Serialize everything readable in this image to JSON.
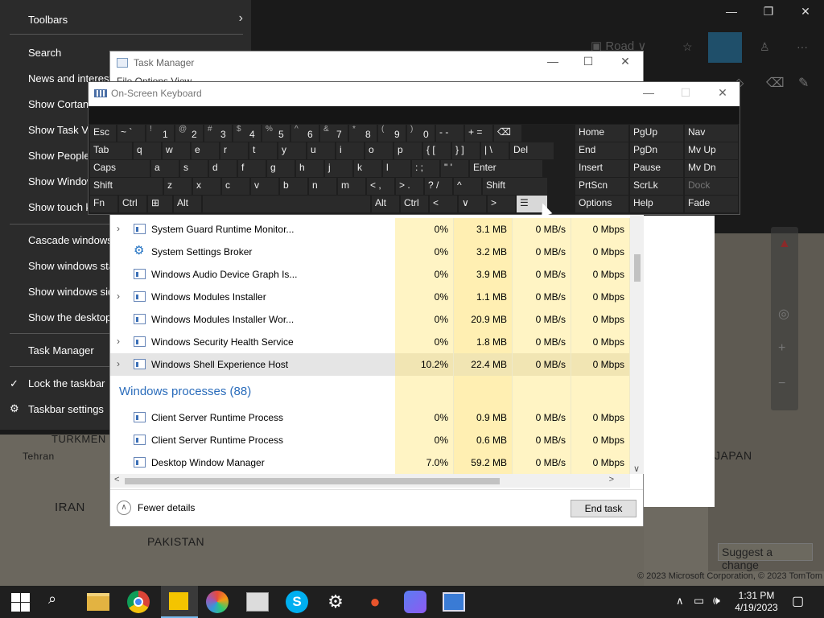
{
  "map": {
    "labels": [
      "TURKMEN",
      "Tehran",
      "IRAN",
      "PAKISTAN",
      "JAPAN"
    ],
    "credit": "© 2023 Microsoft Corporation, © 2023 TomTom",
    "suggest_label": "Suggest a change",
    "road_label": "Road"
  },
  "context_menu": {
    "items": [
      {
        "label": "Toolbars",
        "submenu": true
      },
      {
        "label": "Search",
        "submenu": true
      },
      {
        "label": "News and interests",
        "submenu": true
      },
      {
        "label": "Show Cortana button"
      },
      {
        "label": "Show Task View button"
      },
      {
        "label": "Show People on the taskbar"
      },
      {
        "label": "Show Windows Ink Workspace button"
      },
      {
        "label": "Show touch keyboard button"
      },
      {
        "label": "Cascade windows"
      },
      {
        "label": "Show windows stacked"
      },
      {
        "label": "Show windows side by side"
      },
      {
        "label": "Show the desktop"
      },
      {
        "label": "Task Manager"
      },
      {
        "label": "Lock the taskbar",
        "checked": true
      },
      {
        "label": "Taskbar settings"
      }
    ]
  },
  "task_manager": {
    "title": "Task Manager",
    "menu": "File  Options  View",
    "rows": [
      {
        "name": "System Guard Runtime Monitor...",
        "expandable": true,
        "cpu": "0%",
        "mem": "3.1 MB",
        "disk": "0 MB/s",
        "net": "0 Mbps"
      },
      {
        "name": "System Settings Broker",
        "expandable": false,
        "gear": true,
        "cpu": "0%",
        "mem": "3.2 MB",
        "disk": "0 MB/s",
        "net": "0 Mbps"
      },
      {
        "name": "Windows Audio Device Graph Is...",
        "expandable": false,
        "cpu": "0%",
        "mem": "3.9 MB",
        "disk": "0 MB/s",
        "net": "0 Mbps"
      },
      {
        "name": "Windows Modules Installer",
        "expandable": true,
        "cpu": "0%",
        "mem": "1.1 MB",
        "disk": "0 MB/s",
        "net": "0 Mbps"
      },
      {
        "name": "Windows Modules Installer Wor...",
        "expandable": false,
        "cpu": "0%",
        "mem": "20.9 MB",
        "disk": "0 MB/s",
        "net": "0 Mbps"
      },
      {
        "name": "Windows Security Health Service",
        "expandable": true,
        "cpu": "0%",
        "mem": "1.8 MB",
        "disk": "0 MB/s",
        "net": "0 Mbps"
      },
      {
        "name": "Windows Shell Experience Host",
        "expandable": true,
        "selected": true,
        "cpu": "10.2%",
        "mem": "22.4 MB",
        "disk": "0 MB/s",
        "net": "0 Mbps"
      }
    ],
    "group_label": "Windows processes (88)",
    "group_rows": [
      {
        "name": "Client Server Runtime Process",
        "cpu": "0%",
        "mem": "0.9 MB",
        "disk": "0 MB/s",
        "net": "0 Mbps"
      },
      {
        "name": "Client Server Runtime Process",
        "cpu": "0%",
        "mem": "0.6 MB",
        "disk": "0 MB/s",
        "net": "0 Mbps"
      },
      {
        "name": "Desktop Window Manager",
        "cpu": "7.0%",
        "mem": "59.2 MB",
        "disk": "0 MB/s",
        "net": "0 Mbps"
      }
    ],
    "fewer_details": "Fewer details",
    "end_task": "End task"
  },
  "osk": {
    "title": "On-Screen Keyboard",
    "rows": [
      [
        [
          "Esc",
          ""
        ],
        [
          "~ `",
          ""
        ],
        [
          "!",
          "1"
        ],
        [
          "@",
          "2"
        ],
        [
          "#",
          "3"
        ],
        [
          "$",
          "4"
        ],
        [
          "%",
          "5"
        ],
        [
          "^",
          "6"
        ],
        [
          "&",
          "7"
        ],
        [
          "*",
          "8"
        ],
        [
          "(",
          "9"
        ],
        [
          ")",
          "0"
        ],
        [
          "- -",
          ""
        ],
        [
          "+ =",
          ""
        ],
        [
          "⌫",
          ""
        ]
      ],
      [
        [
          "Tab",
          ""
        ],
        [
          "q",
          ""
        ],
        [
          "w",
          ""
        ],
        [
          "e",
          ""
        ],
        [
          "r",
          ""
        ],
        [
          "t",
          ""
        ],
        [
          "y",
          ""
        ],
        [
          "u",
          ""
        ],
        [
          "i",
          ""
        ],
        [
          "o",
          ""
        ],
        [
          "p",
          ""
        ],
        [
          "{  [",
          ""
        ],
        [
          "}  ]",
          ""
        ],
        [
          "|  \\",
          ""
        ],
        [
          "Del",
          ""
        ]
      ],
      [
        [
          "Caps",
          ""
        ],
        [
          "a",
          ""
        ],
        [
          "s",
          ""
        ],
        [
          "d",
          ""
        ],
        [
          "f",
          ""
        ],
        [
          "g",
          ""
        ],
        [
          "h",
          ""
        ],
        [
          "j",
          ""
        ],
        [
          "k",
          ""
        ],
        [
          "l",
          ""
        ],
        [
          ":  ;",
          ""
        ],
        [
          "\"  '",
          ""
        ],
        [
          "Enter",
          ""
        ]
      ],
      [
        [
          "Shift",
          ""
        ],
        [
          "z",
          ""
        ],
        [
          "x",
          ""
        ],
        [
          "c",
          ""
        ],
        [
          "v",
          ""
        ],
        [
          "b",
          ""
        ],
        [
          "n",
          ""
        ],
        [
          "m",
          ""
        ],
        [
          "<  ,",
          ""
        ],
        [
          ">  .",
          ""
        ],
        [
          "?  /",
          ""
        ],
        [
          "^",
          ""
        ],
        [
          "Shift",
          ""
        ]
      ],
      [
        [
          "Fn",
          ""
        ],
        [
          "Ctrl",
          ""
        ],
        [
          "⊞",
          ""
        ],
        [
          "Alt",
          ""
        ],
        [
          "",
          ""
        ],
        [
          "Alt",
          ""
        ],
        [
          "Ctrl",
          ""
        ],
        [
          "<",
          ""
        ],
        [
          "∨",
          ""
        ],
        [
          ">",
          ""
        ],
        [
          "☰",
          ""
        ]
      ]
    ],
    "nav": [
      [
        "Home",
        "PgUp",
        "Nav"
      ],
      [
        "End",
        "PgDn",
        "Mv Up"
      ],
      [
        "Insert",
        "Pause",
        "Mv Dn"
      ],
      [
        "PrtScn",
        "ScrLk",
        "Dock"
      ],
      [
        "Options",
        "Help",
        "Fade"
      ]
    ]
  },
  "taskbar": {
    "time": "1:31 PM",
    "date": "4/19/2023",
    "apps": [
      "start-icon",
      "search-icon",
      "file-explorer-icon",
      "chrome-icon",
      "sticky-notes-icon",
      "photos-icon",
      "remote-desktop-icon",
      "skype-icon",
      "settings-icon",
      "maps-icon",
      "copilot-icon",
      "snipping-icon"
    ]
  },
  "colors": {
    "accent": "#2a6cbb",
    "cpu_cell": "#fff4c4",
    "mem_cell": "#ffefb2",
    "taskbar": "#1f1f1f",
    "osk_key": "#2a2a2a"
  }
}
